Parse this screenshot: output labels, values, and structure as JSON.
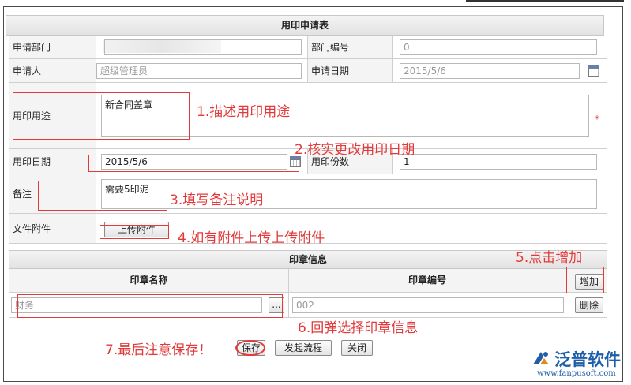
{
  "form": {
    "title": "用印申请表",
    "dept_label": "申请部门",
    "dept_code_label": "部门编号",
    "dept_code_value": "0",
    "applicant_label": "申请人",
    "applicant_value": "超级管理员",
    "apply_date_label": "申请日期",
    "apply_date_value": "2015/5/6",
    "purpose_label": "用印用途",
    "purpose_value": "新合同盖章",
    "required_mark": "*",
    "use_date_label": "用印日期",
    "use_date_value": "2015/5/6",
    "copies_label": "用印份数",
    "copies_value": "1",
    "remark_label": "备注",
    "remark_value": "需要5印泥",
    "attach_label": "文件附件",
    "upload_button": "上传附件"
  },
  "seal": {
    "title": "印章信息",
    "col_name": "印章名称",
    "col_code": "印章编号",
    "add_button": "增加",
    "name_value": "财务",
    "pick_button": "...",
    "code_value": "002",
    "delete_button": "删除"
  },
  "actions": {
    "save": "保存",
    "start_flow": "发起流程",
    "close": "关闭"
  },
  "annotations": {
    "a1": "1.描述用印用途",
    "a2": "2.核实更改用印日期",
    "a3": "3.填写备注说明",
    "a4": "4.如有附件上传上传附件",
    "a5": "5.点击增加",
    "a6": "6.回弹选择印章信息",
    "a7": "7.最后注意保存！"
  },
  "logo": {
    "name": "泛普软件",
    "url": "www.fanpusoft.com",
    "color": "#1f5fa8"
  },
  "colors": {
    "annotation": "#e23a3a",
    "header_bg": "#e8e8e8"
  }
}
